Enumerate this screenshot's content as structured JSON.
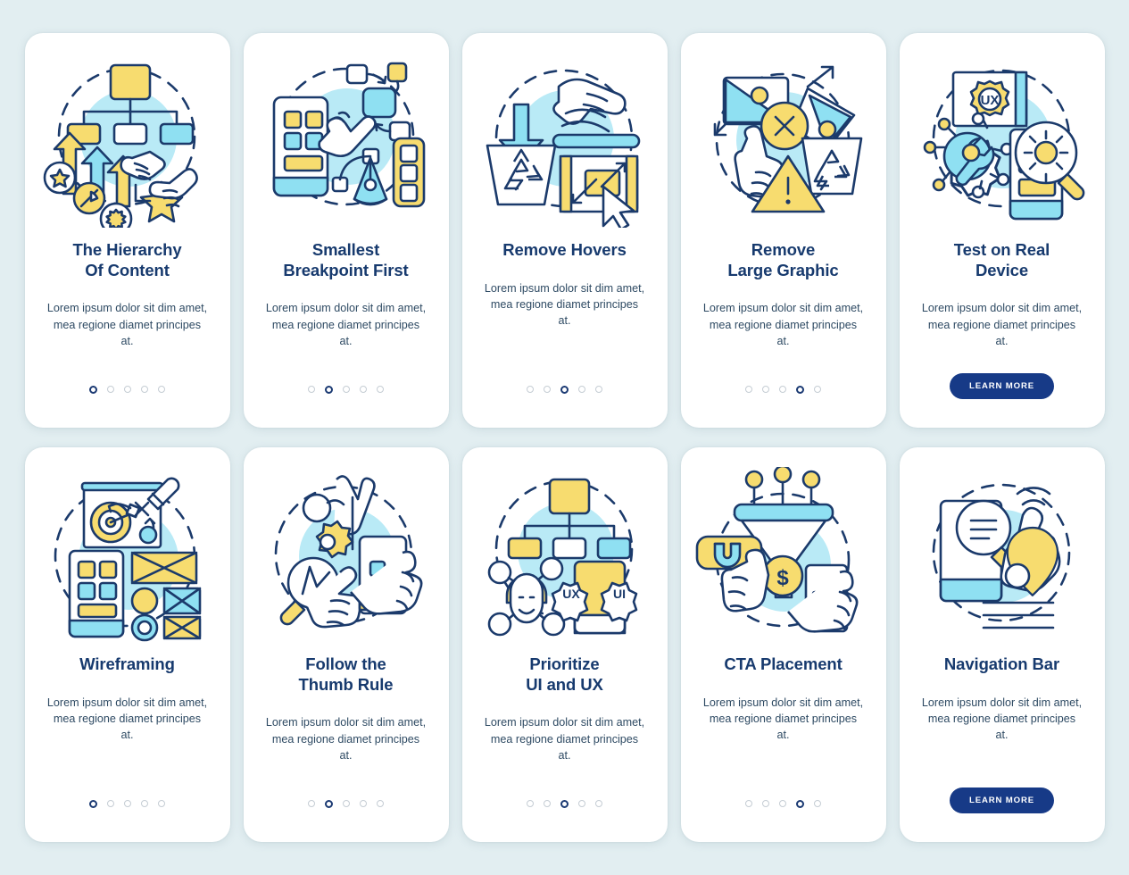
{
  "page": {
    "background_color": "#e2eef1",
    "card_background": "#ffffff",
    "title_color": "#173a6e",
    "body_color": "#2e4a63",
    "accent_yellow": "#f7dc6f",
    "accent_cyan": "#8fe0f2",
    "accent_blue": "#173a87",
    "dot_active_color": "#1b3a73",
    "dot_inactive_color": "#c5cdd4"
  },
  "cards": [
    {
      "id": "hierarchy-of-content",
      "illustration": "content-hierarchy-tree-arrows-icon",
      "title": "The Hierarchy\nOf Content",
      "body": "Lorem ipsum dolor sit dim amet, mea regione diamet principes at.",
      "dots": {
        "count": 5,
        "active": 1
      },
      "button": null
    },
    {
      "id": "smallest-breakpoint-first",
      "illustration": "breakpoint-phone-pen-tool-icon",
      "title": "Smallest\nBreakpoint First",
      "body": "Lorem ipsum dolor sit dim amet, mea regione diamet principes at.",
      "dots": {
        "count": 5,
        "active": 2
      },
      "button": null
    },
    {
      "id": "remove-hovers",
      "illustration": "hand-trash-cursor-icon",
      "title": "Remove Hovers",
      "body": "Lorem ipsum dolor sit dim amet, mea regione diamet principes at.",
      "dots": {
        "count": 5,
        "active": 3
      },
      "button": null
    },
    {
      "id": "remove-large-graphic",
      "illustration": "images-delete-warning-icon",
      "title": "Remove\nLarge Graphic",
      "body": "Lorem ipsum dolor sit dim amet, mea regione diamet principes at.",
      "dots": {
        "count": 5,
        "active": 4
      },
      "button": null
    },
    {
      "id": "test-on-real-device",
      "illustration": "ux-gear-magnifier-device-icon",
      "title": "Test on Real\nDevice",
      "body": "Lorem ipsum dolor sit dim amet, mea regione diamet principes at.",
      "dots": null,
      "button": "LEARN MORE"
    },
    {
      "id": "wireframing",
      "illustration": "wireframe-blocks-pencil-icon",
      "title": "Wireframing",
      "body": "Lorem ipsum dolor sit dim amet, mea regione diamet principes at.",
      "dots": {
        "count": 5,
        "active": 1
      },
      "button": null
    },
    {
      "id": "follow-the-thumb-rule",
      "illustration": "thumb-phone-gear-magnifier-icon",
      "title": "Follow the\nThumb Rule",
      "body": "Lorem ipsum dolor sit dim amet, mea regione diamet principes at.",
      "dots": {
        "count": 5,
        "active": 2
      },
      "button": null
    },
    {
      "id": "prioritize-ui-and-ux",
      "illustration": "user-network-ux-ui-gears-icon",
      "title": "Prioritize\nUI and UX",
      "body": "Lorem ipsum dolor sit dim amet, mea regione diamet principes at.",
      "dots": {
        "count": 5,
        "active": 3
      },
      "button": null
    },
    {
      "id": "cta-placement",
      "illustration": "funnel-magnet-dollar-phone-icon",
      "title": "CTA Placement",
      "body": "Lorem ipsum dolor sit dim amet, mea regione diamet principes at.",
      "dots": {
        "count": 5,
        "active": 4
      },
      "button": null
    },
    {
      "id": "navigation-bar",
      "illustration": "phone-search-pointer-pin-icon",
      "title": "Navigation Bar",
      "body": "Lorem ipsum dolor sit dim amet, mea regione diamet principes at.",
      "dots": null,
      "button": "LEARN MORE"
    }
  ]
}
